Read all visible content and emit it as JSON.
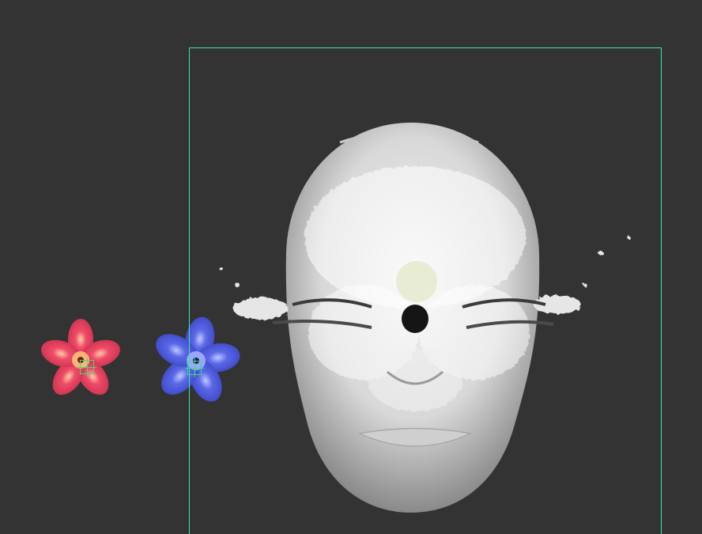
{
  "scene": {
    "background_color": "#333333",
    "selection_frame_color": "#3ee6a0",
    "objects": [
      {
        "name": "face-mask-mesh",
        "icon": "face-mask-icon",
        "color": "#d9d9d9"
      },
      {
        "name": "flower-red",
        "icon": "flower-icon",
        "color": "#e0395a"
      },
      {
        "name": "flower-blue",
        "icon": "flower-icon",
        "color": "#4a55d8"
      },
      {
        "name": "pivot-marker",
        "icon": "light-bulb-icon",
        "color": "#e8ecd4"
      }
    ]
  }
}
